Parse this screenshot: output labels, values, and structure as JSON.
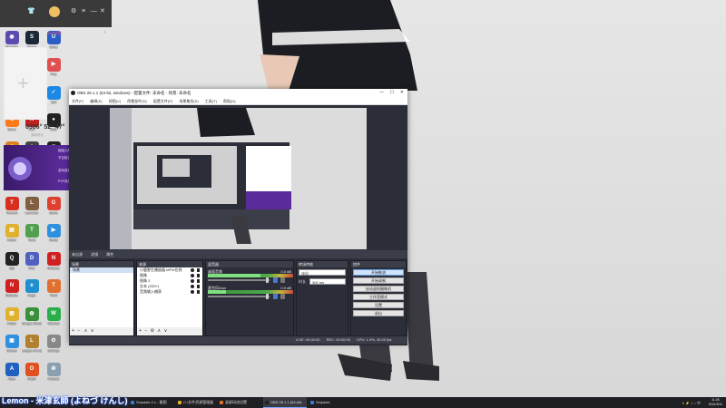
{
  "desktop": {
    "icons": [
      {
        "label": "Google",
        "color": "#d8d8d8",
        "glyph": "G"
      },
      {
        "label": "QQ",
        "color": "#2b8ef0",
        "glyph": "Q"
      },
      {
        "label": "IT",
        "color": "#e55a2a",
        "glyph": "I"
      },
      {
        "label": "Obsidian",
        "color": "#5b4bb0",
        "glyph": "◉"
      },
      {
        "label": "Steam",
        "color": "#1b2838",
        "glyph": "S"
      },
      {
        "label": "Uplay",
        "color": "#2a5dc6",
        "glyph": "U"
      },
      {
        "label": "Wallpaper",
        "color": "#5c8f5c",
        "glyph": "W"
      },
      {
        "label": "Steam",
        "color": "#1b2838",
        "glyph": "S"
      },
      {
        "label": "Play",
        "color": "#e05050",
        "glyph": "▶"
      },
      {
        "label": "Tieba",
        "color": "#4f86e8",
        "glyph": "贴"
      },
      {
        "label": "MSI",
        "color": "#c02020",
        "glyph": "M"
      },
      {
        "label": "360",
        "color": "#1e88e5",
        "glyph": "✓"
      },
      {
        "label": "Stove",
        "color": "#ff7a1a",
        "glyph": "S"
      },
      {
        "label": "Red",
        "color": "#c02020",
        "glyph": "R"
      },
      {
        "label": "OBS",
        "color": "#222222",
        "glyph": "●"
      },
      {
        "label": "Games",
        "color": "#e08020",
        "glyph": "G"
      },
      {
        "label": "Assassin",
        "color": "#444444",
        "glyph": "A"
      },
      {
        "label": "Epic Games",
        "color": "#222222",
        "glyph": "E"
      },
      {
        "label": "Ubisoft",
        "color": "#888888",
        "glyph": "U"
      },
      {
        "label": "Ubisoft Connect",
        "color": "#2a2a2a",
        "glyph": "U"
      },
      {
        "label": "Valorant",
        "color": "#d49020",
        "glyph": "V"
      },
      {
        "label": "Tencent",
        "color": "#d83020",
        "glyph": "T"
      },
      {
        "label": "Launcher",
        "color": "#806040",
        "glyph": "L"
      },
      {
        "label": "Game",
        "color": "#e04030",
        "glyph": "G"
      },
      {
        "label": "Folder",
        "color": "#e0b030",
        "glyph": "▤"
      },
      {
        "label": "Tools",
        "color": "#50a050",
        "glyph": "T"
      },
      {
        "label": "Media",
        "color": "#3090e0",
        "glyph": "▶"
      },
      {
        "label": "QQ",
        "color": "#222222",
        "glyph": "Q"
      },
      {
        "label": "Disc",
        "color": "#5060c0",
        "glyph": "D"
      },
      {
        "label": "NetEase",
        "color": "#d02020",
        "glyph": "N"
      },
      {
        "label": "NetEase",
        "color": "#d02020",
        "glyph": "N"
      },
      {
        "label": "Edge",
        "color": "#1f8fd0",
        "glyph": "e"
      },
      {
        "label": "Tools",
        "color": "#e07030",
        "glyph": "T"
      },
      {
        "label": "Folder",
        "color": "#e0b030",
        "glyph": "▤"
      },
      {
        "label": "Google Chrome",
        "color": "#3a8f3a",
        "glyph": "◍"
      },
      {
        "label": "WeChat",
        "color": "#2aae4a",
        "glyph": "W"
      },
      {
        "label": "Screen",
        "color": "#3090e0",
        "glyph": "▣"
      },
      {
        "label": "League of Legends",
        "color": "#b08030",
        "glyph": "L"
      },
      {
        "label": "Settings",
        "color": "#888888",
        "glyph": "⚙"
      },
      {
        "label": "Apex",
        "color": "#2060c0",
        "glyph": "A"
      },
      {
        "label": "Origin",
        "color": "#e05020",
        "glyph": "O"
      },
      {
        "label": "Recycle",
        "color": "#8aa0b0",
        "glyph": "♻"
      }
    ]
  },
  "obs": {
    "title": "OBS 26.1.1 (64-bit, windows) - 配置文件: 未命名 - 场景: 未命名",
    "menu": [
      "文件(F)",
      "编辑(E)",
      "视图(V)",
      "停靠部件(D)",
      "配置文件(P)",
      "场景集合(S)",
      "工具(T)",
      "帮助(H)"
    ],
    "scene_bar": [
      "来自源",
      "滤镜",
      "属性"
    ],
    "scenes_header": "场景",
    "scenes": [
      "场景"
    ],
    "sources_header": "来源",
    "sources": [
      "小鹿野生播放器 MP3/在线",
      "图像",
      "图像 2",
      "文本 (GDI+)",
      "音频输入捕获"
    ],
    "mixer_header": "混音器",
    "mixer": [
      {
        "name": "桌面音频",
        "db": "0.0 dB"
      },
      {
        "name": "麦克风/Aux",
        "db": "0.0 dB"
      }
    ],
    "transitions_header": "转场特效",
    "transition_value": "淡出",
    "duration_label": "时长",
    "duration_value": "300 ms",
    "controls_header": "控件",
    "controls": [
      "开始推流",
      "开始录制",
      "启动虚拟摄像机",
      "工作室模式",
      "设置",
      "退出"
    ],
    "status": [
      "LIVE: 00:00:00",
      "REC: 00:00:00",
      "CPU: 1.9%, 30.00 fps"
    ]
  },
  "rec_app": {
    "tab_label": "本地录屏",
    "timer": "0306° 52° 47°",
    "timer_sub": "录制时长",
    "start_button": "开始录制",
    "banner_lines": [
      "超级大屏幕第二季",
      "节目组温馨提示",
      "游戏直播推荐",
      "PVP竞技游戏推荐"
    ]
  },
  "taskbar": {
    "items": [
      {
        "label": "Snipaste 2.x - 截图",
        "color": "#3a7ad0"
      },
      {
        "label": "C:/文件资源管理器",
        "color": "#e0b030"
      },
      {
        "label": "录屏码流设置",
        "color": "#e07030"
      },
      {
        "label": "OBS 26.1.1 (64-bit)",
        "color": "#222222"
      },
      {
        "label": "Snipaste",
        "color": "#3a7ad0"
      }
    ],
    "clock_time": "11:26",
    "clock_date": "2021/3/11"
  },
  "lyric": "Lemon - 米津玄師 (よねづ けんし)"
}
